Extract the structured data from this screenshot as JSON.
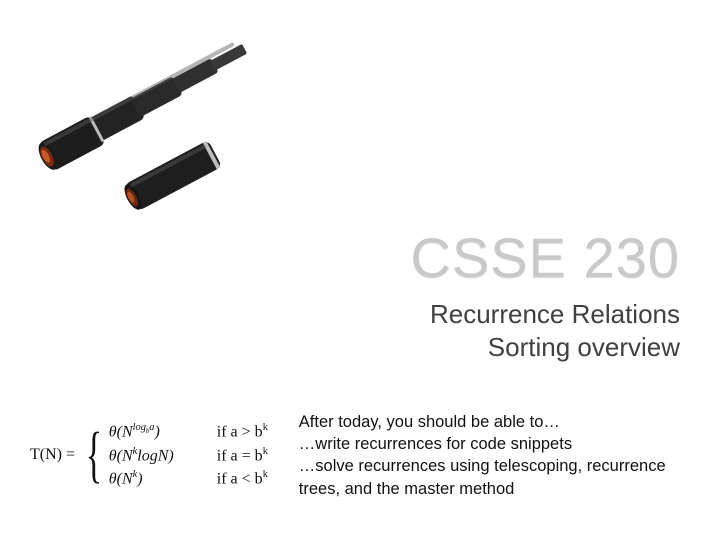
{
  "image": {
    "alt": "Two black collapsible telescopes (spyglasses), one extended and one retracted."
  },
  "title": "CSSE 230",
  "subtitle_line1": "Recurrence Relations",
  "subtitle_line2": "Sorting overview",
  "formula": {
    "lhs": "T(N) = ",
    "cases": [
      {
        "expr_html": "θ(N<sup>log<sub>b</sub>a</sup>)",
        "cond_html": "if a > b<sup>k</sup>"
      },
      {
        "expr_html": "θ(N<sup>k</sup>logN)",
        "cond_html": "if a = b<sup>k</sup>"
      },
      {
        "expr_html": "θ(N<sup>k</sup>)",
        "cond_html": "if a < b<sup>k</sup>"
      }
    ]
  },
  "objectives_html": "After today, you should be able to…<br>…write recurrences for code snippets<br>…solve recurrences using telescoping, recurrence trees, and the master method"
}
